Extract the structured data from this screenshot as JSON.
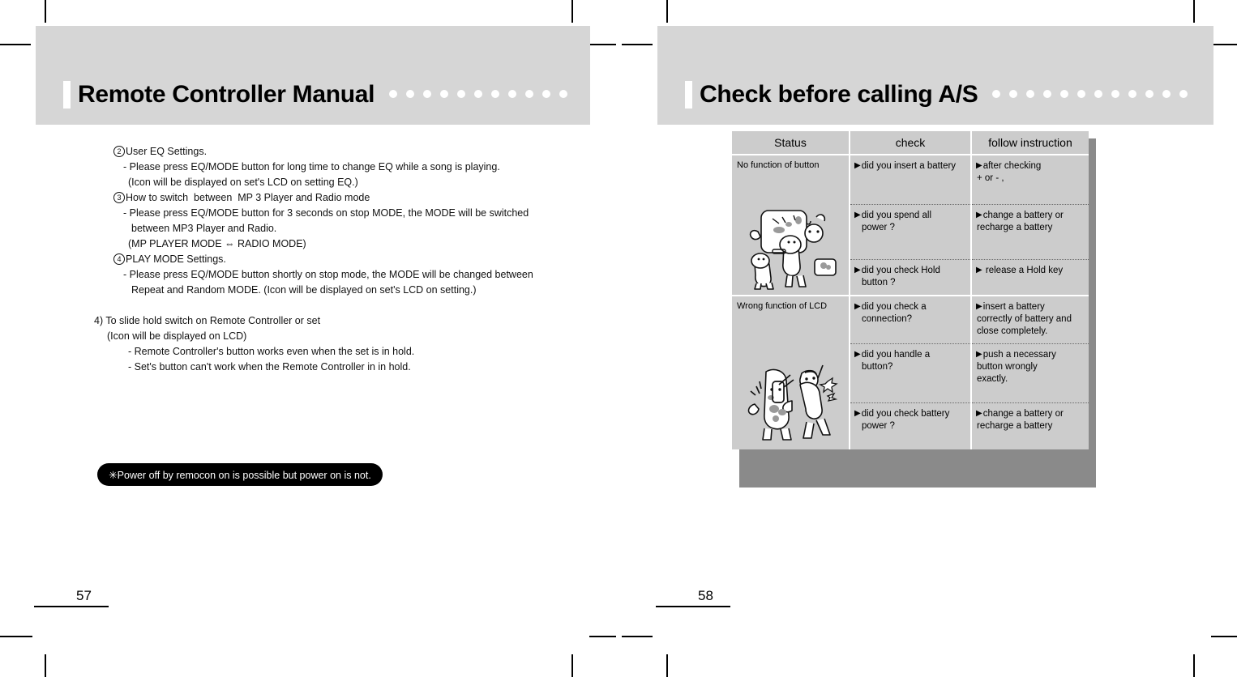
{
  "left_page": {
    "header_title": "Remote Controller Manual",
    "header_dot_count": 11,
    "page_number": "57",
    "lines": [
      {
        "circled": "2",
        "text": "User EQ Settings.",
        "indent": 30
      },
      {
        "text": "- Please press EQ/MODE button for long time to change EQ while a song is playing.",
        "indent": 42
      },
      {
        "text": "(Icon will be displayed on set's LCD on setting EQ.)",
        "indent": 48
      },
      {
        "circled": "3",
        "text": "How to switch  between  MP 3 Player and Radio mode",
        "indent": 30
      },
      {
        "text": "- Please press EQ/MODE button for 3 seconds on stop MODE, the MODE will be switched",
        "indent": 42
      },
      {
        "text": "between MP3 Player and Radio.",
        "indent": 52
      },
      {
        "text": "(MP PLAYER MODE ⇔ RADIO MODE)",
        "indent": 48
      },
      {
        "circled": "4",
        "text": "PLAY MODE Settings.",
        "indent": 30
      },
      {
        "text": "- Please press EQ/MODE button shortly on stop mode, the MODE will be changed between",
        "indent": 42
      },
      {
        "text": "Repeat and Random MODE. (Icon will be displayed on set's LCD on setting.)",
        "indent": 52
      },
      {
        "blank": true
      },
      {
        "text": "4) To slide hold switch on Remote Controller or set",
        "indent": 6
      },
      {
        "text": "(Icon will be displayed on LCD)",
        "indent": 22
      },
      {
        "text": "- Remote Controller's button works even when the set is in hold.",
        "indent": 48
      },
      {
        "text": "- Set's button can't work when the Remote Controller in in hold.",
        "indent": 48
      }
    ],
    "callout": "✳Power off by remocon on is possible but power on is not."
  },
  "right_page": {
    "header_title": "Check before calling A/S",
    "header_dot_count": 12,
    "page_number": "58",
    "table": {
      "headers": [
        "Status",
        "check",
        "follow instruction"
      ],
      "groups": [
        {
          "status": "No function of button",
          "illustration": "two-characters-with-portable-player-icon",
          "rows": [
            {
              "check": [
                "did you insert a battery"
              ],
              "follow": [
                "after checking",
                "+ or - ,"
              ],
              "follow_indent_from": 1
            },
            {
              "check": [
                "did you spend all",
                "power ?"
              ],
              "follow": [
                "change a battery or",
                "recharge a battery"
              ],
              "follow_indent_from": 1
            },
            {
              "check": [
                "did you check Hold",
                "button ?"
              ],
              "follow": [
                " release a Hold key"
              ],
              "follow_indent_from": 9
            }
          ]
        },
        {
          "status": "Wrong function of LCD",
          "illustration": "character-kicking-device-icon",
          "rows": [
            {
              "check": [
                "did you check a",
                "connection?"
              ],
              "follow": [
                "insert a battery",
                "correctly of battery and",
                "close completely."
              ],
              "follow_indent_from": 1
            },
            {
              "check": [
                "did you handle a",
                "button?"
              ],
              "follow": [
                "push a necessary",
                "button wrongly",
                "exactly."
              ],
              "follow_indent_from": 1
            },
            {
              "check": [
                "did you check battery",
                "power ?"
              ],
              "follow": [
                "change a battery or",
                "recharge a battery"
              ],
              "follow_indent_from": 1
            }
          ]
        }
      ]
    }
  },
  "colors": {
    "header_band": "#d6d6d6",
    "table_cell": "#cccccc",
    "table_shadow": "#8a8a8a",
    "callout_bg": "#000000",
    "text": "#111111"
  }
}
